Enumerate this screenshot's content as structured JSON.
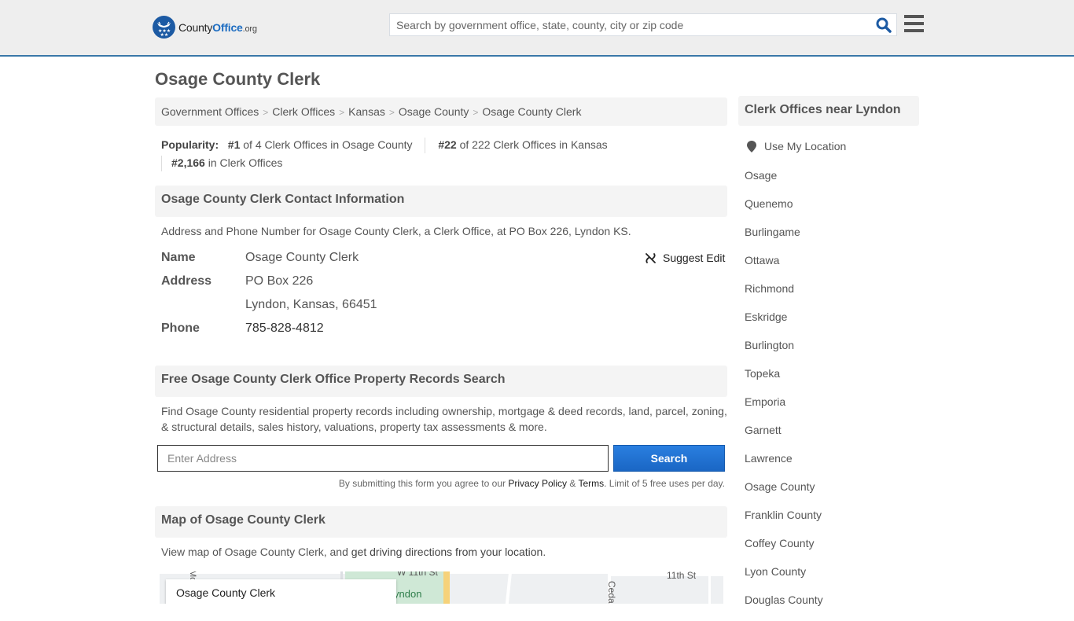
{
  "header": {
    "logo": {
      "prefix": "County",
      "brand": "Office",
      "tld": ".org"
    },
    "search_placeholder": "Search by government office, state, county, city or zip code",
    "search_icon": "search-icon",
    "menu_icon": "hamburger-menu-icon"
  },
  "page": {
    "title": "Osage County Clerk"
  },
  "breadcrumb": [
    "Government Offices",
    "Clerk Offices",
    "Kansas",
    "Osage County",
    "Osage County Clerk"
  ],
  "breadcrumb_separator": ">",
  "popularity": {
    "label": "Popularity:",
    "items": [
      {
        "rank": "#1",
        "text": " of 4 Clerk Offices in Osage County"
      },
      {
        "rank": "#22",
        "text": " of 222 Clerk Offices in Kansas"
      },
      {
        "rank": "#2,166",
        "text": " in Clerk Offices"
      }
    ]
  },
  "contact": {
    "heading": "Osage County Clerk Contact Information",
    "intro": "Address and Phone Number for Osage County Clerk, a Clerk Office, at PO Box 226, Lyndon KS.",
    "suggest_edit": "Suggest Edit",
    "fields": {
      "name_label": "Name",
      "name_value": "Osage County Clerk",
      "address_label": "Address",
      "address_line1": "PO Box 226",
      "address_line2": "Lyndon, Kansas, 66451",
      "phone_label": "Phone",
      "phone_value": "785-828-4812"
    }
  },
  "property_search": {
    "heading": "Free Osage County Clerk Office Property Records Search",
    "description": "Find Osage County residential property records including ownership, mortgage & deed records, land, parcel, zoning, & structural details, sales history, valuations, property tax assessments & more.",
    "input_placeholder": "Enter Address",
    "button_label": "Search",
    "disclaimer_prefix": "By submitting this form you agree to our ",
    "privacy_link": "Privacy Policy",
    "amp": " & ",
    "terms_link": "Terms",
    "disclaimer_suffix": ". Limit of 5 free uses per day."
  },
  "map_section": {
    "heading": "Map of Osage County Clerk",
    "intro_prefix": "View map of Osage County Clerk, and ",
    "directions_link": "get driving directions from your location",
    "intro_suffix": ".",
    "map_card_title": "Osage County Clerk",
    "map_labels": {
      "street_11th": "11th St",
      "cedar": "Ceda",
      "park": "yndon",
      "top_street": "W 11th St",
      "left_street": "Mc"
    }
  },
  "sidebar": {
    "heading": "Clerk Offices near Lyndon",
    "use_location": "Use My Location",
    "links": [
      "Osage",
      "Quenemo",
      "Burlingame",
      "Ottawa",
      "Richmond",
      "Eskridge",
      "Burlington",
      "Topeka",
      "Emporia",
      "Garnett",
      "Lawrence",
      "Osage County",
      "Franklin County",
      "Coffey County",
      "Lyon County",
      "Douglas County"
    ]
  },
  "colors": {
    "brand_blue": "#1c5aa3",
    "header_border": "#3a78a8",
    "button_blue": "#1a66c4",
    "section_bg": "#f4f4f4"
  }
}
